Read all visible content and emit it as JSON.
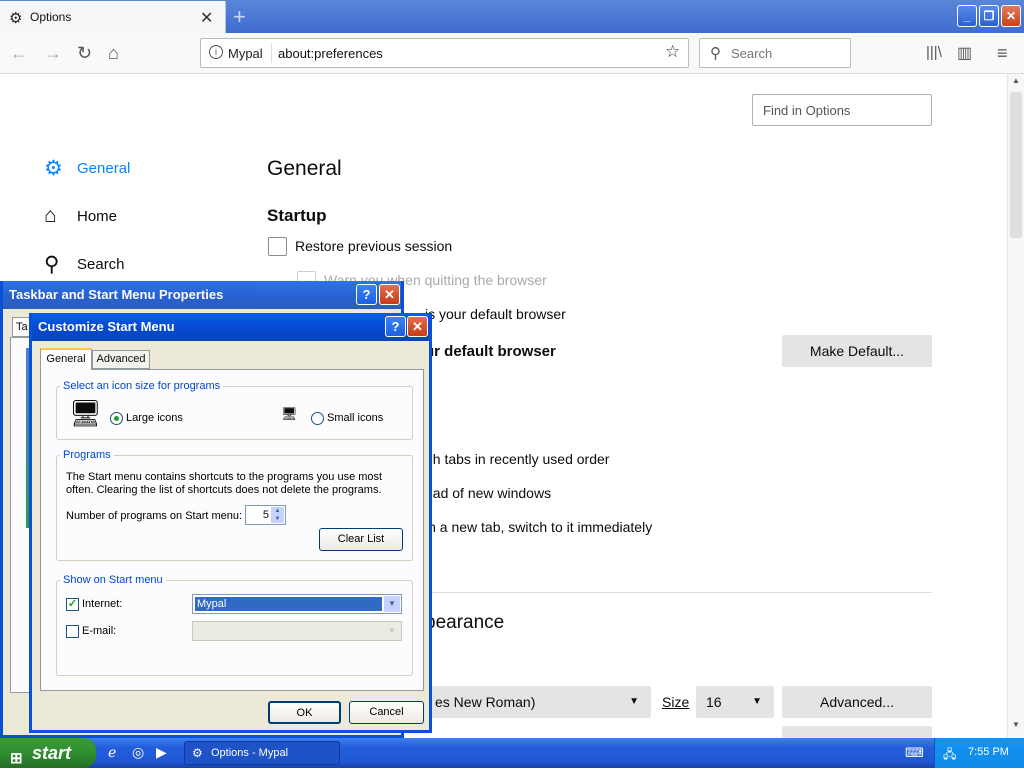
{
  "browser": {
    "tab_title": "Options",
    "tab_icon": "gear-icon",
    "close_glyph": "✕",
    "new_tab_glyph": "+",
    "identity_label": "Mypal",
    "url": "about:preferences",
    "search_placeholder": "Search"
  },
  "prefs": {
    "find_placeholder": "Find in Options",
    "nav": [
      {
        "label": "General",
        "icon": "gear-icon",
        "selected": true
      },
      {
        "label": "Home",
        "icon": "home-icon"
      },
      {
        "label": "Search",
        "icon": "search-icon"
      }
    ],
    "page_title": "General",
    "startup_heading": "Startup",
    "restore_session": "Restore previous session",
    "warn_quit": "Warn you when quitting the browser",
    "check_default": "is your default browser",
    "not_default": "ur default browser",
    "make_default_btn": "Make Default...",
    "tabs_ctrl_tab": "gh tabs in recently used order",
    "open_new_windows": "ead of new windows",
    "switch_new_tab": "in a new tab, switch to it immediately",
    "appearance_heading": "pearance",
    "font_value": "es New Roman)",
    "size_label": "Size",
    "size_value": "16",
    "advanced_btn": "Advanced..."
  },
  "taskbar_props": {
    "title": "Taskbar and Start Menu Properties",
    "tab_stub": "Ta"
  },
  "customize": {
    "title": "Customize Start Menu",
    "tabs": [
      "General",
      "Advanced"
    ],
    "icon_size_group": "Select an icon size for programs",
    "large_icons": "Large icons",
    "small_icons": "Small icons",
    "programs_group": "Programs",
    "programs_text": "The Start menu contains shortcuts to the programs you use most often. Clearing the list of shortcuts does not delete the programs.",
    "num_programs_label": "Number of programs on Start menu:",
    "num_programs_value": "5",
    "clear_list_btn": "Clear List",
    "show_group": "Show on Start menu",
    "internet_label": "Internet:",
    "internet_value": "Mypal",
    "email_label": "E-mail:",
    "ok_btn": "OK",
    "cancel_btn": "Cancel"
  },
  "taskbar": {
    "start_label": "start",
    "task_label": "Options - Mypal",
    "clock": "7:55 PM"
  },
  "colors": {
    "accent": "#0a84ff",
    "xp_title": "#0a5fe8",
    "taskbar": "#245edb"
  }
}
